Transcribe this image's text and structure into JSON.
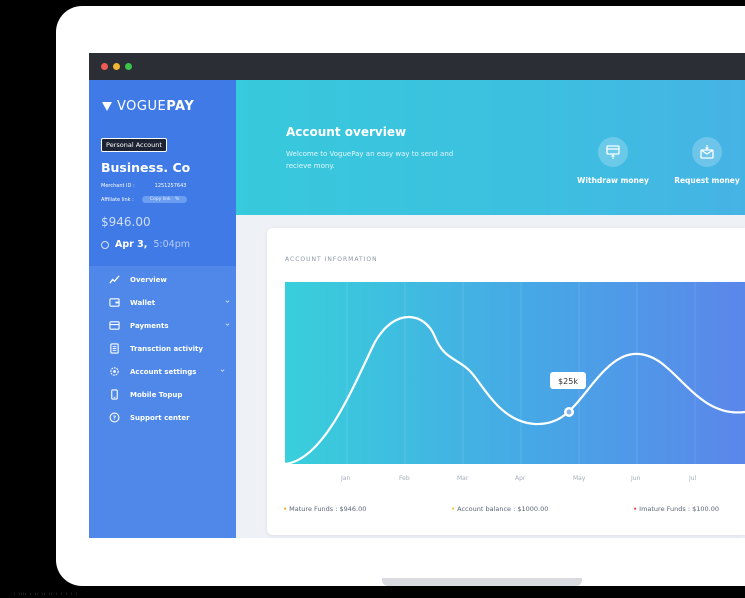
{
  "window": {
    "brand": "VOGUE",
    "brand_bold": "PAY"
  },
  "account": {
    "badge": "Personal Account",
    "name": "Business. Co",
    "merchant_label": "Merchant ID :",
    "merchant_id": "1251257643",
    "affiliate_label": "Affiliate link :",
    "copy_label": "Copy link",
    "balance": "$946.00",
    "date": "Apr 3,",
    "time": "5:04pm"
  },
  "nav": {
    "items": [
      {
        "label": "Overview",
        "icon": "trend-chart-icon",
        "chevron": false
      },
      {
        "label": "Wallet",
        "icon": "wallet-icon",
        "chevron": true
      },
      {
        "label": "Payments",
        "icon": "card-icon",
        "chevron": true
      },
      {
        "label": "Transction activity",
        "icon": "document-icon",
        "chevron": false
      },
      {
        "label": "Account settings",
        "icon": "gear-icon",
        "chevron": true
      },
      {
        "label": "Mobile Topup",
        "icon": "phone-icon",
        "chevron": false
      },
      {
        "label": "Support center",
        "icon": "help-icon",
        "chevron": false
      }
    ]
  },
  "banner": {
    "title": "Account overview",
    "subtitle": "Welcome to VoguePay an easy way to send and recieve mony.",
    "actions": [
      {
        "label": "Withdraw money",
        "icon": "withdraw-card-icon"
      },
      {
        "label": "Request money",
        "icon": "request-mail-icon"
      }
    ]
  },
  "card": {
    "heading": "ACCOUNT INFORMATION",
    "tooltip": "$25k"
  },
  "chart_data": {
    "type": "line",
    "categories": [
      "Jan",
      "Feb",
      "Mar",
      "Apr",
      "May",
      "Jun",
      "Jul"
    ],
    "highlight": {
      "category": "May",
      "label": "$25k"
    }
  },
  "legend": [
    {
      "text": "Mature Funds : $946.00",
      "color": "#f5a623"
    },
    {
      "text": "Account balance : $1000.00",
      "color": "#f5c542"
    },
    {
      "text": "Imature Funds : $100.00",
      "color": "#e8425a"
    }
  ],
  "colors": {
    "sidebar": "#4f88e8",
    "sidebar_top": "#3f7ae6",
    "banner": "#37c9dc",
    "accent_line": "#ffffff"
  }
}
